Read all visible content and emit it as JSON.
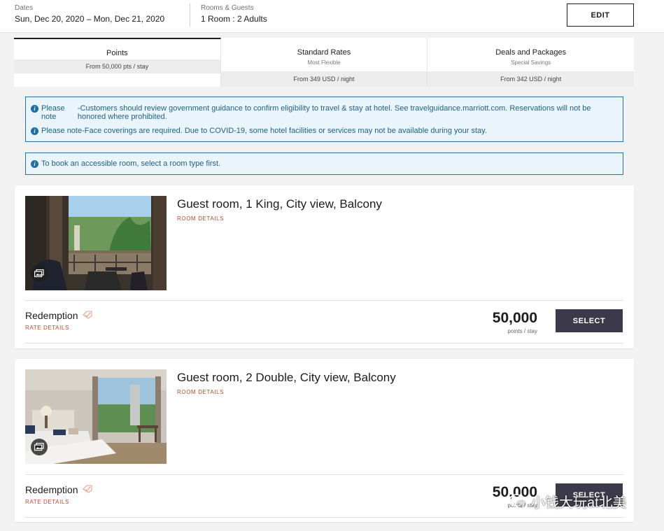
{
  "search": {
    "dates_label": "Dates",
    "dates_value": "Sun, Dec 20, 2020 – Mon, Dec 21, 2020",
    "guests_label": "Rooms & Guests",
    "guests_value": "1 Room : 2 Adults",
    "edit_label": "EDIT"
  },
  "rate_tabs": [
    {
      "title": "Points",
      "subtitle": "",
      "price": "From 50,000 pts / stay",
      "active": true
    },
    {
      "title": "Standard Rates",
      "subtitle": "Most Flexible",
      "price": "From 349 USD / night",
      "active": false
    },
    {
      "title": "Deals and Packages",
      "subtitle": "Special Savings",
      "price": "From 342 USD / night",
      "active": false
    }
  ],
  "notices": {
    "note1_lead": "Please note",
    "note1_text": "-Customers should review government guidance to confirm eligibility to travel & stay at hotel. See travelguidance.marriott.com. Reservations will not be honored where prohibited.",
    "note2_text": "Please note-Face coverings are required. Due to COVID-19, some hotel facilities or services may not be available during your stay.",
    "accessible_text": "To book an accessible room, select a room type first."
  },
  "rooms": [
    {
      "title": "Guest room, 1 King, City view, Balcony",
      "details_label": "ROOM DETAILS",
      "rate_name": "Redemption",
      "rate_details_label": "RATE DETAILS",
      "points": "50,000",
      "points_unit": "points / stay",
      "select_label": "SELECT"
    },
    {
      "title": "Guest room, 2 Double, City view, Balcony",
      "details_label": "ROOM DETAILS",
      "rate_name": "Redemption",
      "rate_details_label": "RATE DETAILS",
      "points": "50,000",
      "points_unit": "points / stay",
      "select_label": "SELECT"
    }
  ],
  "watermark": {
    "text": "小钱大玩at北美"
  },
  "colors": {
    "accent_link": "#b84a25",
    "select_button": "#3c3a4a",
    "notice_border": "#2a6f97",
    "notice_bg": "#eaf4fb"
  },
  "icons": {
    "info": "info-icon",
    "gallery": "gallery-icon",
    "tag": "tag-icon"
  }
}
